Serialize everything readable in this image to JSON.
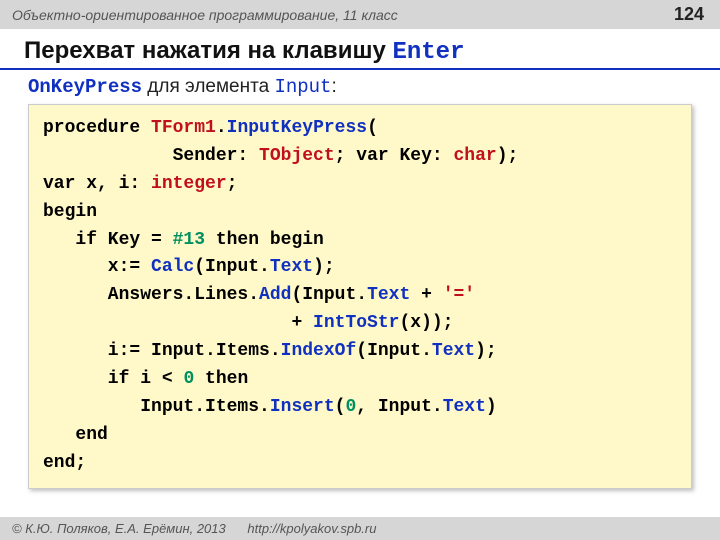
{
  "header": {
    "course": "Объектно-ориентированное программирование, 11 класс",
    "page": "124"
  },
  "title": {
    "text": "Перехват нажатия на клавишу ",
    "keyword": "Enter"
  },
  "subhead": {
    "method": "OnKeyPress",
    "mid": " для элемента ",
    "element": "Input",
    "tail": ":"
  },
  "code": {
    "t": {
      "procedure": "procedure ",
      "tform": "TForm1",
      "dot": ".",
      "ikp": "InputKeyPress",
      "lp": "(",
      "indent1": "            ",
      "sender": "Sender: ",
      "tobject": "TObject",
      "semi_var": "; var Key: ",
      "char": "char",
      "rp": ");",
      "varxi": "var x, i: ",
      "integer": "integer",
      "semi": ";",
      "begin": "begin",
      "ifkey": "   if Key = ",
      "hash13": "#13",
      "thenbegin": " then begin",
      "xcalc_pre": "      x:= ",
      "calc": "Calc",
      "xcalc_mid": "(Input.",
      "text1": "Text",
      "xcalc_end": ");",
      "ans_pre": "      Answers.Lines.",
      "add": "Add",
      "ans_mid": "(Input.",
      "text2": "Text",
      "plus": " + ",
      "eqstr": "'='",
      "cont_indent": "                       + ",
      "inttostr": "IntToStr",
      "cont_end": "(x));",
      "iidx_pre": "      i:= Input.Items.",
      "indexof": "IndexOf",
      "iidx_mid": "(Input.",
      "text3": "Text",
      "iidx_end": ");",
      "ifi": "      if i < ",
      "zero": "0",
      "then": " then",
      "ins_pre": "         Input.Items.",
      "insert": "Insert",
      "ins_mid": "(",
      "zero2": "0",
      "ins_mid2": ", Input.",
      "text4": "Text",
      "ins_end": ")",
      "end1": "   end",
      "end2": "end;"
    }
  },
  "footer": {
    "copyright": "© К.Ю. Поляков, Е.А. Ерёмин, 2013",
    "url": "http://kpolyakov.spb.ru"
  }
}
